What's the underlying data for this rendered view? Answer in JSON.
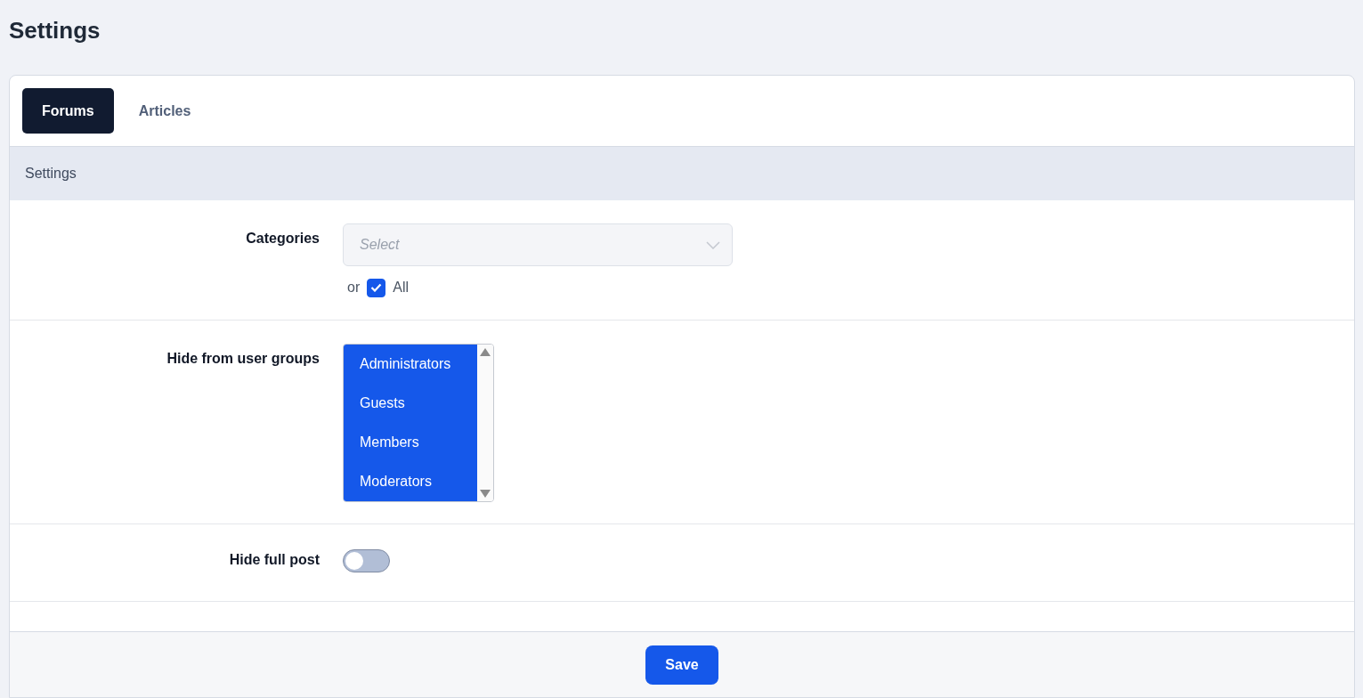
{
  "page_title": "Settings",
  "tabs": [
    {
      "label": "Forums",
      "selected": true
    },
    {
      "label": "Articles",
      "selected": false
    }
  ],
  "section_header": "Settings",
  "fields": [
    {
      "kind": "multiselect",
      "label": "Categories",
      "placeholder": "Select",
      "or_text": "or",
      "all_label": "All",
      "all_checked": true
    },
    {
      "kind": "listbox",
      "label": "Hide from user groups",
      "options": [
        {
          "label": "Administrators",
          "selected": true
        },
        {
          "label": "Guests",
          "selected": true
        },
        {
          "label": "Members",
          "selected": true
        },
        {
          "label": "Moderators",
          "selected": true
        }
      ]
    },
    {
      "kind": "toggle",
      "label": "Hide full post",
      "on": false
    },
    {
      "kind": "empty"
    }
  ],
  "save_button": "Save"
}
